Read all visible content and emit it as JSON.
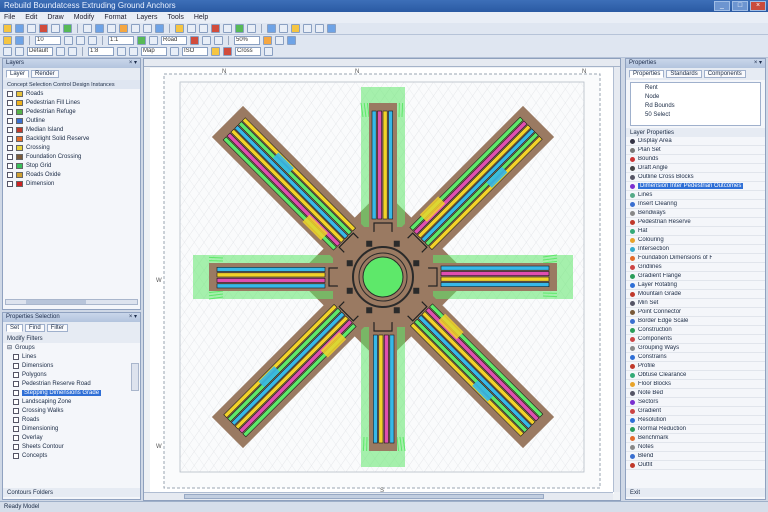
{
  "window": {
    "title": "Rebuild Boundatcess Extruding Ground Anchors"
  },
  "menu": [
    "File",
    "Edit",
    "Draw",
    "Modify",
    "Format",
    "Layers",
    "Tools",
    "Help"
  ],
  "toolbar2": {
    "combo1": "10",
    "combo2": "1:1",
    "combo3": "Road",
    "combo4": "50%"
  },
  "toolbar3": {
    "combo1": "Default",
    "combo2": "1:8",
    "combo3": "Map",
    "combo4": "ISO",
    "combo5": "Cross"
  },
  "left_top": {
    "header": "Layers",
    "tabs": [
      "Layer",
      "Render"
    ],
    "column_header": "Concept Selection Control Design Instances",
    "items": [
      {
        "label": "Roads",
        "color": "#e8c23a"
      },
      {
        "label": "Pedestrian Fill Lines",
        "color": "#f0b21c"
      },
      {
        "label": "Pedestrian Refuge",
        "color": "#56b34a"
      },
      {
        "label": "Outline",
        "color": "#3a6fd0"
      },
      {
        "label": "Median Island",
        "color": "#c0392b"
      },
      {
        "label": "Backlight Solid Reserve",
        "color": "#e36b2a"
      },
      {
        "label": "Crossing",
        "color": "#e8d23a"
      },
      {
        "label": "Foundation Crossing",
        "color": "#7a5a3a"
      },
      {
        "label": "Stop Grid",
        "color": "#3ac05a"
      },
      {
        "label": "Roads Oxide",
        "color": "#d0a030"
      },
      {
        "label": "Dimension",
        "color": "#c22"
      }
    ]
  },
  "left_bottom": {
    "header": "Properties Selection",
    "tabs": [
      "Set",
      "Find",
      "Filter"
    ],
    "subheader": "Modify Filters",
    "group": "Groups",
    "items": [
      {
        "label": "Lines"
      },
      {
        "label": "Dimensions"
      },
      {
        "label": "Polygons"
      },
      {
        "label": "Pedestrian Reserve Road"
      },
      {
        "label": "Stepping Dimensions Grade",
        "selected": true
      },
      {
        "label": "Landscaping Zone"
      },
      {
        "label": "Crossing Walks"
      },
      {
        "label": "Roads"
      },
      {
        "label": "Dimensioning"
      },
      {
        "label": "Overlay"
      },
      {
        "label": "Sheets Contour"
      },
      {
        "label": "Concepts"
      }
    ],
    "footer": "Contours Folders"
  },
  "right_panel": {
    "header": "Properties",
    "tabs": [
      "Properties",
      "Standards",
      "Components"
    ],
    "list_items": [
      "Rent",
      "Node",
      "Rd Bounds",
      "50 Select"
    ],
    "section": "Layer Properties",
    "rows": [
      {
        "label": "Display Area",
        "color": "#334"
      },
      {
        "label": "Plan Set",
        "color": "#777"
      },
      {
        "label": "Bounds",
        "color": "#c33"
      },
      {
        "label": "Draft Angle",
        "color": "#444"
      },
      {
        "label": "Outline Cross Blocks",
        "color": "#556"
      },
      {
        "label": "Dimension Inter Pedestrian Outcomes",
        "color": "#7b2fd0",
        "selected": true
      },
      {
        "label": "Lines",
        "color": "#5a8"
      },
      {
        "label": "Insert Clearing",
        "color": "#3a6fd0"
      },
      {
        "label": "Bendways",
        "color": "#888"
      },
      {
        "label": "Pedestrian Reserve",
        "color": "#c0392b"
      },
      {
        "label": "Hat",
        "color": "#3a7"
      },
      {
        "label": "Colouring",
        "color": "#e8a32a"
      },
      {
        "label": "Intersection",
        "color": "#3ac"
      },
      {
        "label": "Foundation Dimensions of Features",
        "color": "#e36b2a"
      },
      {
        "label": "Gridlines",
        "color": "#c44"
      },
      {
        "label": "Gradient Flange",
        "color": "#2a9d5a"
      },
      {
        "label": "Layer Rotating",
        "color": "#2f6fd6"
      },
      {
        "label": "Mountain Grade",
        "color": "#c0392b"
      },
      {
        "label": "Min Set",
        "color": "#556"
      },
      {
        "label": "Point Connector",
        "color": "#7a5a3a"
      },
      {
        "label": "Border Edge Scale",
        "color": "#3a6fd0"
      },
      {
        "label": "Construction",
        "color": "#2a9d5a"
      },
      {
        "label": "Components",
        "color": "#c44"
      },
      {
        "label": "Grouping Ways",
        "color": "#888"
      },
      {
        "label": "Constrains",
        "color": "#2f6fd6"
      },
      {
        "label": "Profile",
        "color": "#c0392b"
      },
      {
        "label": "Obtuse Clearance",
        "color": "#3a7"
      },
      {
        "label": "Floor Blocks",
        "color": "#e8a32a"
      },
      {
        "label": "Note Bed",
        "color": "#556"
      },
      {
        "label": "Sectors",
        "color": "#7b2fd0"
      },
      {
        "label": "Gradient",
        "color": "#c44"
      },
      {
        "label": "Resolution",
        "color": "#2f6fd6"
      },
      {
        "label": "Normal Reduction",
        "color": "#2a9d5a"
      },
      {
        "label": "Benchmark",
        "color": "#e36b2a"
      },
      {
        "label": "Notes",
        "color": "#888"
      },
      {
        "label": "Blend",
        "color": "#3a6fd0"
      },
      {
        "label": "Outfit",
        "color": "#c0392b"
      }
    ],
    "footer": "Exit"
  },
  "canvas": {
    "top_marks": [
      "N",
      "N",
      "N"
    ],
    "left_marks": [
      "W",
      "W"
    ],
    "bottom_marks": [
      "S"
    ]
  },
  "status": {
    "text": "Ready  Model"
  },
  "colors": {
    "road": "#9a7a62",
    "lane_green": "#5ee86a",
    "lane_blue": "#37b8e8",
    "lane_magenta": "#e04fb0",
    "lane_yellow": "#f2d22a"
  }
}
